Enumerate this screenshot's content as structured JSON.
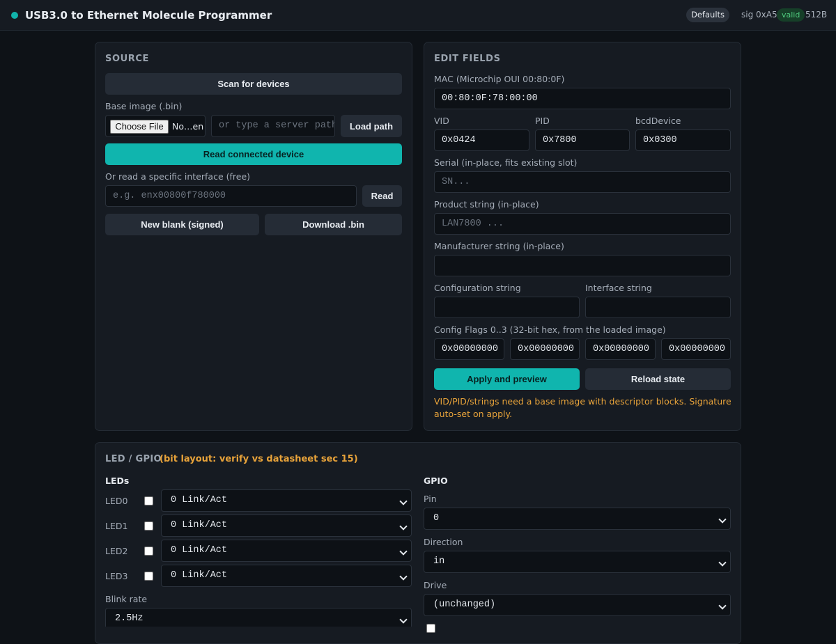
{
  "header": {
    "title": "USB3.0 to Ethernet Molecule Programmer",
    "defaults_label": "Defaults",
    "sig_text": "sig 0xA5",
    "valid_label": "valid",
    "size_text": "512B",
    "status_color": "#11b3ab"
  },
  "source": {
    "title": "SOURCE",
    "scan_button": "Scan for devices",
    "base_image_label": "Base image (.bin)",
    "choose_file_button": "Choose File",
    "file_name": "No…en",
    "server_path_placeholder": "or type a server path",
    "load_path_button": "Load path",
    "read_connected_button": "Read connected device",
    "interface_label": "Or read a specific interface (free)",
    "interface_placeholder": "e.g. enx00800f780000",
    "read_button": "Read",
    "new_blank_button": "New blank (signed)",
    "download_button": "Download .bin"
  },
  "edit": {
    "title": "EDIT FIELDS",
    "mac_label": "MAC (Microchip OUI 00:80:0F)",
    "mac_value": "00:80:0F:78:00:00",
    "vid_label": "VID",
    "vid_value": "0x0424",
    "pid_label": "PID",
    "pid_value": "0x7800",
    "bcd_label": "bcdDevice",
    "bcd_value": "0x0300",
    "serial_label": "Serial (in-place, fits existing slot)",
    "serial_placeholder": "SN...",
    "product_label": "Product string (in-place)",
    "product_placeholder": "LAN7800 ...",
    "manufacturer_label": "Manufacturer string (in-place)",
    "manufacturer_value": "",
    "config_string_label": "Configuration string",
    "config_string_value": "",
    "interface_string_label": "Interface string",
    "interface_string_value": "",
    "flags_label": "Config Flags 0..3 (32-bit hex, from the loaded image)",
    "flags": [
      "0x00000000",
      "0x00000000",
      "0x00000000",
      "0x00000000"
    ],
    "apply_button": "Apply and preview",
    "reload_button": "Reload state",
    "warning": "VID/PID/strings need a base image with descriptor blocks. Signature auto-set on apply."
  },
  "led_gpio": {
    "title": "LED / GPIO",
    "note": "(bit layout: verify vs datasheet sec 15)",
    "leds_heading": "LEDs",
    "leds": [
      {
        "label": "LED0",
        "mode": "0 Link/Act"
      },
      {
        "label": "LED1",
        "mode": "0 Link/Act"
      },
      {
        "label": "LED2",
        "mode": "0 Link/Act"
      },
      {
        "label": "LED3",
        "mode": "0 Link/Act"
      }
    ],
    "blink_label": "Blink rate",
    "blink_value": "2.5Hz",
    "gpio_heading": "GPIO",
    "pin_label": "Pin",
    "pin_value": "0",
    "direction_label": "Direction",
    "direction_value": "in",
    "drive_label": "Drive",
    "drive_value": "(unchanged)",
    "note_color": "#e8a33a"
  }
}
